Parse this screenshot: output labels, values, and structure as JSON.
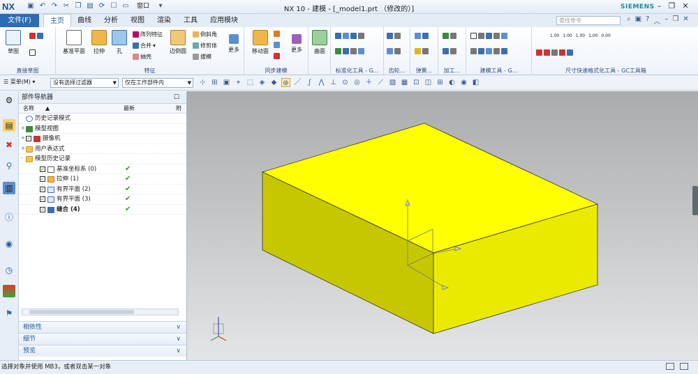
{
  "app": {
    "logo": "NX",
    "title": "NX 10 - 建模 - [_model1.prt （修改的）]",
    "brand": "SIEMENS",
    "window_menu": "窗口"
  },
  "menu": {
    "file": "文件(F)",
    "tabs": [
      "主页",
      "曲线",
      "分析",
      "视图",
      "渲染",
      "工具",
      "应用模块"
    ],
    "active_tab": "主页",
    "search_placeholder": "查找命令"
  },
  "ribbon": {
    "sketch": "草图",
    "group_direct_sketch": "直接草图",
    "datum_plane": "基准平面",
    "extrude": "拉伸",
    "hole": "孔",
    "pattern_feature": "阵列特征",
    "unite": "合并",
    "shell": "抽壳",
    "edge_blend": "边倒圆",
    "chamfer": "倒斜角",
    "trim_body": "修剪体",
    "draft": "拔模",
    "more": "更多",
    "group_feature": "特征",
    "move_face": "移动面",
    "group_sync": "同步建模",
    "surface": "曲面",
    "group_standard_parts": "标准化工具 - G...",
    "group_gear": "齿轮...",
    "group_spring": "弹簧...",
    "group_machining": "加工...",
    "group_modeling_tools": "建模工具 - G...",
    "group_dimension": "尺寸快速格式化工具 - GC工具箱",
    "dim_labels": [
      "1.00",
      "1.00",
      "1.00",
      "1.00",
      "0.00"
    ]
  },
  "toolbar2": {
    "menu": "菜单(M)",
    "filter": "没有选择过滤器",
    "scope": "仅在工作部件内"
  },
  "navigator": {
    "title": "部件导航器",
    "col_name": "名称",
    "col_latest": "最新",
    "col_extra": "附",
    "items": [
      {
        "label": "历史记录模式"
      },
      {
        "label": "模型视图"
      },
      {
        "label": "摄像机"
      },
      {
        "label": "用户表达式"
      },
      {
        "label": "模型历史记录"
      },
      {
        "label": "基准坐标系 (0)",
        "latest": "✔"
      },
      {
        "label": "拉伸 (1)",
        "latest": "✔"
      },
      {
        "label": "有界平面 (2)",
        "latest": "✔"
      },
      {
        "label": "有界平面 (3)",
        "latest": "✔"
      },
      {
        "label": "缝合 (4)",
        "latest": "✔"
      }
    ],
    "panels": [
      "相依性",
      "细节",
      "预览"
    ]
  },
  "status": {
    "text": "选择对象并使用 MB3，或者双击某一对象"
  },
  "colors": {
    "accent": "#2c6cb5",
    "box_top": "#ffff00",
    "box_front": "#c7c700",
    "box_side": "#eaea00",
    "check": "#2b9a2b"
  }
}
